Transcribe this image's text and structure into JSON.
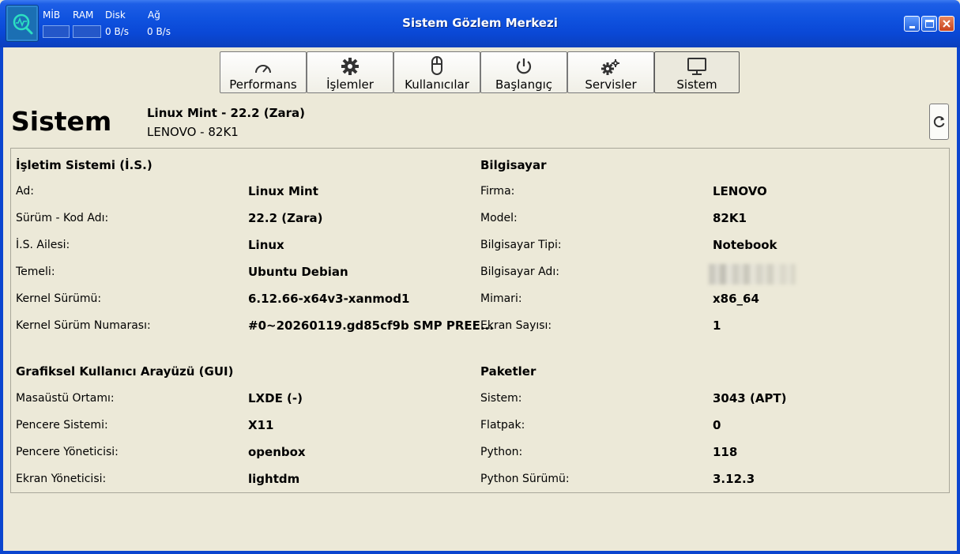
{
  "window": {
    "title": "Sistem Gözlem Merkezi",
    "monitor": {
      "cpu_label": "MİB",
      "ram_label": "RAM",
      "disk_label": "Disk",
      "disk_value": "0 B/s",
      "net_label": "Ağ",
      "net_value": "0 B/s"
    }
  },
  "tabs": [
    {
      "label": "Performans",
      "icon": "gauge-icon"
    },
    {
      "label": "İşlemler",
      "icon": "gear-icon"
    },
    {
      "label": "Kullanıcılar",
      "icon": "mouse-icon"
    },
    {
      "label": "Başlangıç",
      "icon": "power-icon"
    },
    {
      "label": "Servisler",
      "icon": "gears-icon"
    },
    {
      "label": "Sistem",
      "icon": "monitor-icon",
      "active": true
    }
  ],
  "header": {
    "title": "Sistem",
    "os_line": "Linux Mint - 22.2 (Zara)",
    "machine_line": "LENOVO - 82K1"
  },
  "os": {
    "heading": "İşletim Sistemi (İ.S.)",
    "rows": [
      {
        "label": "Ad:",
        "value": "Linux Mint"
      },
      {
        "label": "Sürüm - Kod Adı:",
        "value": "22.2 (Zara)"
      },
      {
        "label": "İ.S. Ailesi:",
        "value": "Linux"
      },
      {
        "label": "Temeli:",
        "value": "Ubuntu Debian"
      },
      {
        "label": "Kernel Sürümü:",
        "value": "6.12.66-x64v3-xanmod1"
      },
      {
        "label": "Kernel Sürüm Numarası:",
        "value": "#0~20260119.gd85cf9b SMP PREE..."
      }
    ]
  },
  "gui": {
    "heading": "Grafiksel Kullanıcı Arayüzü (GUI)",
    "rows": [
      {
        "label": "Masaüstü Ortamı:",
        "value": "LXDE (-)"
      },
      {
        "label": "Pencere Sistemi:",
        "value": "X11"
      },
      {
        "label": "Pencere Yöneticisi:",
        "value": "openbox"
      },
      {
        "label": "Ekran Yöneticisi:",
        "value": "lightdm"
      }
    ]
  },
  "computer": {
    "heading": "Bilgisayar",
    "rows": [
      {
        "label": "Firma:",
        "value": "LENOVO"
      },
      {
        "label": "Model:",
        "value": "82K1"
      },
      {
        "label": "Bilgisayar Tipi:",
        "value": "Notebook"
      },
      {
        "label": "Bilgisayar Adı:",
        "value": ""
      },
      {
        "label": "Mimari:",
        "value": "x86_64"
      },
      {
        "label": "Ekran Sayısı:",
        "value": "1"
      }
    ]
  },
  "packages": {
    "heading": "Paketler",
    "rows": [
      {
        "label": "Sistem:",
        "value": "3043 (APT)"
      },
      {
        "label": "Flatpak:",
        "value": "0"
      },
      {
        "label": "Python:",
        "value": "118"
      },
      {
        "label": "Python Sürümü:",
        "value": "3.12.3"
      }
    ]
  }
}
